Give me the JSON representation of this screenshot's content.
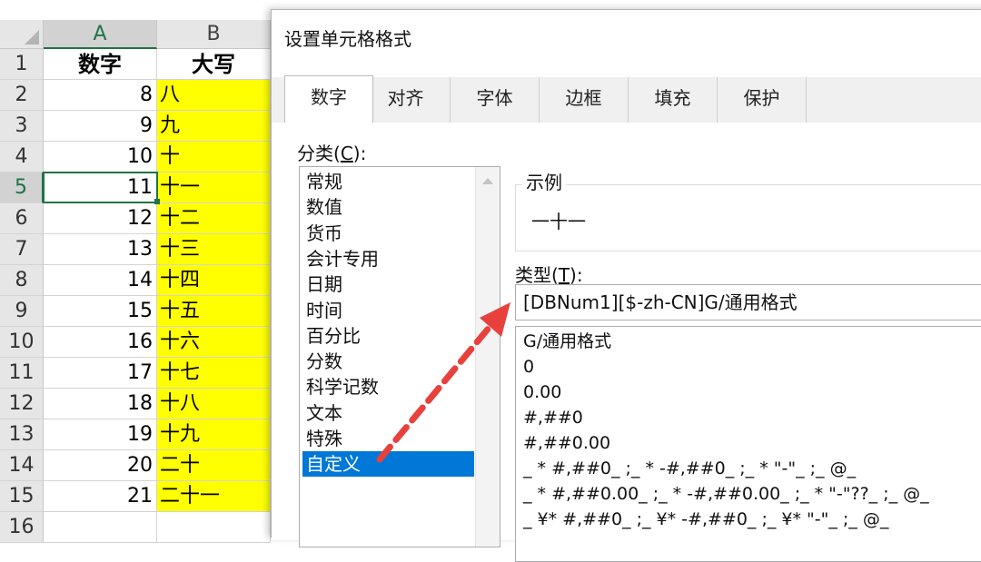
{
  "sheet": {
    "columns": [
      "A",
      "B"
    ],
    "header_row": {
      "row": "1",
      "a": "数字",
      "b": "大写"
    },
    "rows": [
      {
        "row": "2",
        "a": "8",
        "b": "八"
      },
      {
        "row": "3",
        "a": "9",
        "b": "九"
      },
      {
        "row": "4",
        "a": "10",
        "b": "十"
      },
      {
        "row": "5",
        "a": "11",
        "b": "十一"
      },
      {
        "row": "6",
        "a": "12",
        "b": "十二"
      },
      {
        "row": "7",
        "a": "13",
        "b": "十三"
      },
      {
        "row": "8",
        "a": "14",
        "b": "十四"
      },
      {
        "row": "9",
        "a": "15",
        "b": "十五"
      },
      {
        "row": "10",
        "a": "16",
        "b": "十六"
      },
      {
        "row": "11",
        "a": "17",
        "b": "十七"
      },
      {
        "row": "12",
        "a": "18",
        "b": "十八"
      },
      {
        "row": "13",
        "a": "19",
        "b": "十九"
      },
      {
        "row": "14",
        "a": "20",
        "b": "二十"
      },
      {
        "row": "15",
        "a": "21",
        "b": "二十一"
      }
    ],
    "partial_row": "16",
    "active_cell": "A5",
    "fill_color": "#ffff00",
    "accent_color": "#217346"
  },
  "dialog": {
    "title": "设置单元格格式",
    "tabs": [
      "数字",
      "对齐",
      "字体",
      "边框",
      "填充",
      "保护"
    ],
    "active_tab": "数字",
    "category": {
      "label_text": "分类(",
      "label_key": "C",
      "label_end": "):",
      "items": [
        "常规",
        "数值",
        "货币",
        "会计专用",
        "日期",
        "时间",
        "百分比",
        "分数",
        "科学记数",
        "文本",
        "特殊",
        "自定义"
      ],
      "selected": "自定义"
    },
    "sample": {
      "legend": "示例",
      "value": "一十一"
    },
    "type": {
      "label_text": "类型(",
      "label_key": "T",
      "label_end": "):",
      "value": "[DBNum1][$-zh-CN]G/通用格式",
      "formats": [
        "G/通用格式",
        "0",
        "0.00",
        "#,##0",
        "#,##0.00",
        "_ * #,##0_ ;_ * -#,##0_ ;_ * \"-\"_ ;_ @_",
        "_ * #,##0.00_ ;_ * -#,##0.00_ ;_ * \"-\"??_ ;_ @_",
        "_ ¥* #,##0_ ;_ ¥* -#,##0_ ;_ ¥* \"-\"_ ;_ @_"
      ]
    },
    "selection_color": "#0078d7"
  },
  "annotation": {
    "arrow_color": "#e8413c",
    "from": "自定义",
    "to": "类型"
  }
}
